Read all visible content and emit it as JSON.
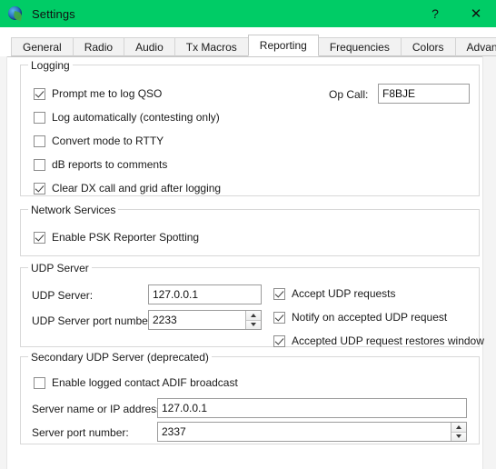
{
  "window": {
    "title": "Settings",
    "icon": "wsjtx-globe-icon",
    "accent_color": "#00cc66",
    "help_button": "?",
    "close_button": "✕"
  },
  "tabs": [
    {
      "label": "General",
      "active": false
    },
    {
      "label": "Radio",
      "active": false
    },
    {
      "label": "Audio",
      "active": false
    },
    {
      "label": "Tx Macros",
      "active": false
    },
    {
      "label": "Reporting",
      "active": true
    },
    {
      "label": "Frequencies",
      "active": false
    },
    {
      "label": "Colors",
      "active": false
    },
    {
      "label": "Advanced",
      "active": false
    }
  ],
  "groups": {
    "logging": {
      "legend": "Logging",
      "checkboxes": [
        {
          "label": "Prompt me to log QSO",
          "checked": true
        },
        {
          "label": "Log automatically (contesting only)",
          "checked": false
        },
        {
          "label": "Convert mode to RTTY",
          "checked": false
        },
        {
          "label": "dB reports to comments",
          "checked": false
        },
        {
          "label": "Clear DX call and grid after logging",
          "checked": true
        }
      ],
      "op_call_label": "Op Call:",
      "op_call_value": "F8BJE"
    },
    "network_services": {
      "legend": "Network Services",
      "checkboxes": [
        {
          "label": "Enable PSK Reporter Spotting",
          "checked": true
        }
      ]
    },
    "udp_server": {
      "legend": "UDP Server",
      "server_label": "UDP Server:",
      "server_value": "127.0.0.1",
      "port_label": "UDP Server port number:",
      "port_value": "2233",
      "checkboxes": [
        {
          "label": "Accept UDP requests",
          "checked": true
        },
        {
          "label": "Notify on accepted UDP request",
          "checked": true
        },
        {
          "label": "Accepted UDP request restores window",
          "checked": true
        }
      ]
    },
    "secondary_udp_server": {
      "legend": "Secondary UDP Server (deprecated)",
      "checkboxes": [
        {
          "label": "Enable logged contact ADIF broadcast",
          "checked": false
        }
      ],
      "server_label": "Server name or IP address:",
      "server_value": "127.0.0.1",
      "port_label": "Server port number:",
      "port_value": "2337"
    }
  }
}
